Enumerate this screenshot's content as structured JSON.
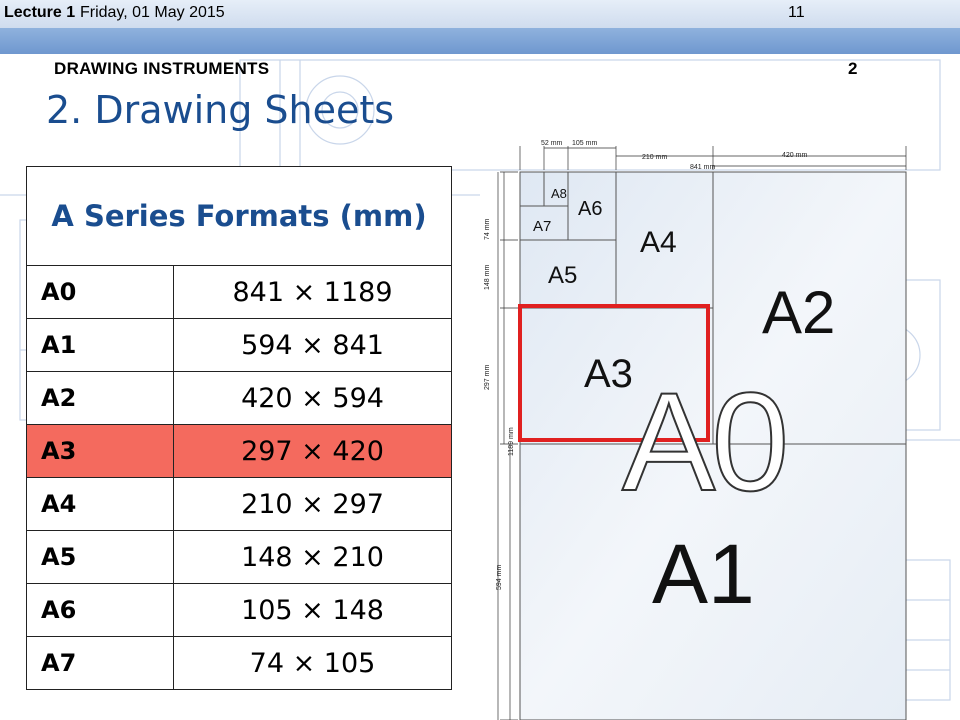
{
  "header": {
    "lecture": "Lecture 1",
    "date": "Friday, 01 May 2015",
    "page": "11",
    "section": "DRAWING INSTRUMENTS",
    "section_num": "2"
  },
  "title": "2. Drawing Sheets",
  "table": {
    "heading": "A Series Formats (mm)",
    "rows": [
      {
        "code": "A0",
        "size": "841 × 1189"
      },
      {
        "code": "A1",
        "size": "594 × 841"
      },
      {
        "code": "A2",
        "size": "420 × 594"
      },
      {
        "code": "A3",
        "size": "297 × 420"
      },
      {
        "code": "A4",
        "size": "210 × 297"
      },
      {
        "code": "A5",
        "size": "148 × 210"
      },
      {
        "code": "A6",
        "size": "105 × 148"
      },
      {
        "code": "A7",
        "size": "74 × 105"
      }
    ],
    "highlight_color": "#f46a5e"
  },
  "diagram": {
    "labels": {
      "a0": "A0",
      "a1": "A1",
      "a2": "A2",
      "a3": "A3",
      "a4": "A4",
      "a5": "A5",
      "a6": "A6",
      "a7": "A7",
      "a8": "A8"
    },
    "dims": {
      "d52": "52 mm",
      "d105": "105 mm",
      "d210": "210 mm",
      "d420": "420 mm",
      "d841": "841 mm",
      "d74": "74 mm",
      "d148": "148 mm",
      "d297": "297 mm",
      "d1189": "1189 mm",
      "d594": "594 mm"
    },
    "highlight_color": "#e02020"
  }
}
